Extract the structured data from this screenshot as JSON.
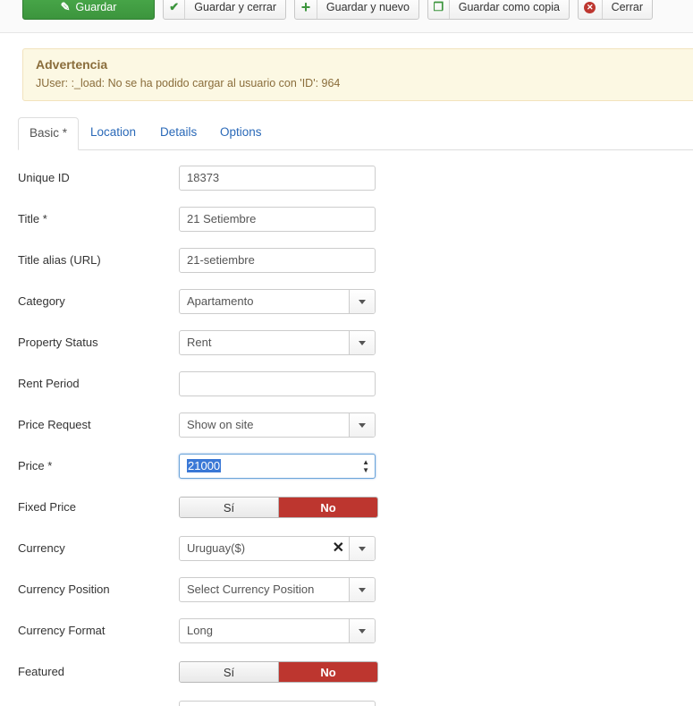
{
  "toolbar": {
    "save": "Guardar",
    "save_close": "Guardar y cerrar",
    "save_new": "Guardar y nuevo",
    "save_copy": "Guardar como copia",
    "close": "Cerrar"
  },
  "alert": {
    "title": "Advertencia",
    "message": "JUser: :_load: No se ha podido cargar al usuario con 'ID': 964"
  },
  "tabs": [
    "Basic *",
    "Location",
    "Details",
    "Options"
  ],
  "form": {
    "unique_id": {
      "label": "Unique ID",
      "value": "18373"
    },
    "title": {
      "label": "Title *",
      "value": "21 Setiembre"
    },
    "alias": {
      "label": "Title alias (URL)",
      "value": "21-setiembre"
    },
    "category": {
      "label": "Category",
      "value": "Apartamento"
    },
    "property_status": {
      "label": "Property Status",
      "value": "Rent"
    },
    "rent_period": {
      "label": "Rent Period",
      "value": ""
    },
    "price_request": {
      "label": "Price Request",
      "value": "Show on site"
    },
    "price": {
      "label": "Price *",
      "value": "21000"
    },
    "fixed_price": {
      "label": "Fixed Price",
      "yes": "Sí",
      "no": "No",
      "selected": "No"
    },
    "currency": {
      "label": "Currency",
      "value": "Uruguay($)"
    },
    "currency_position": {
      "label": "Currency Position",
      "value": "Select Currency Position"
    },
    "currency_format": {
      "label": "Currency Format",
      "value": "Long"
    },
    "featured": {
      "label": "Featured",
      "yes": "Sí",
      "no": "No",
      "selected": "No"
    }
  },
  "colors": {
    "save_green": "#3c953d",
    "toggle_on_red": "#bd362f",
    "link_blue": "#2a69b8",
    "warning_bg": "#fcf8e3"
  }
}
